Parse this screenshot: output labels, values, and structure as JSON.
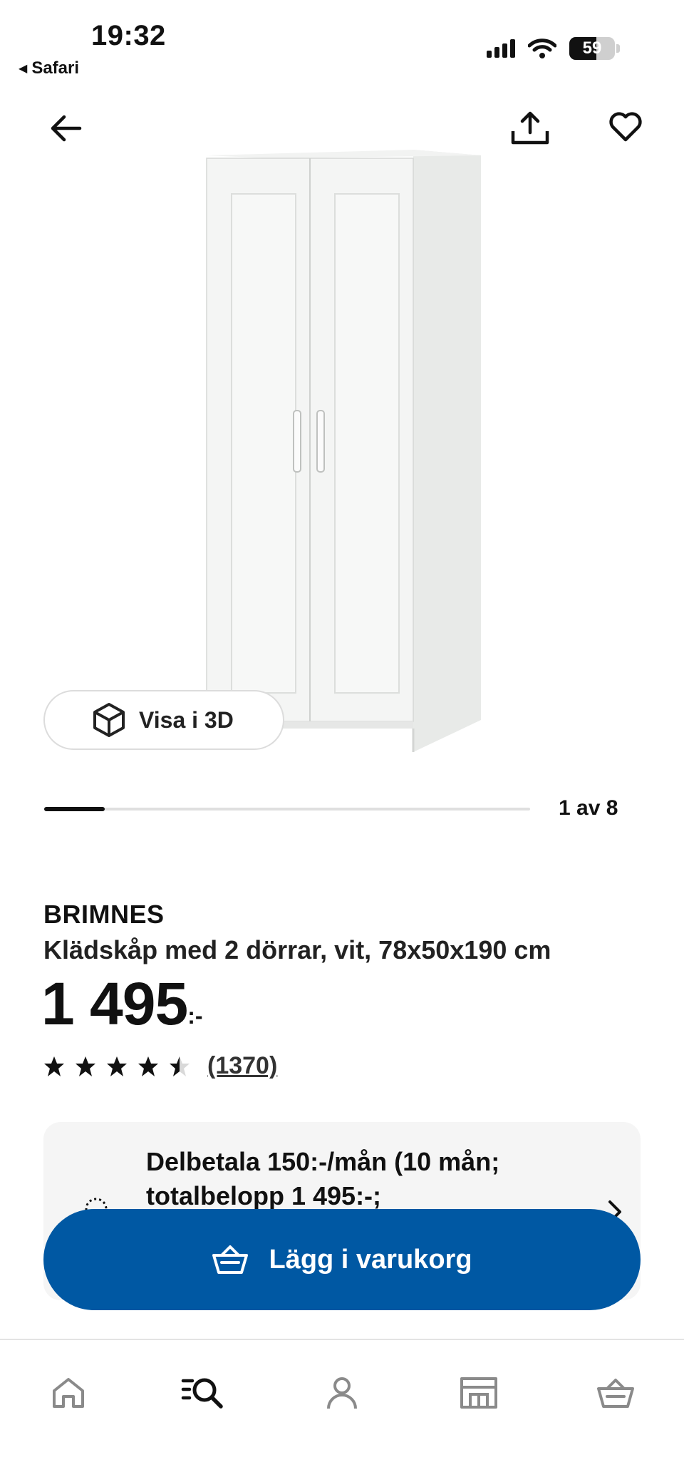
{
  "status_bar": {
    "time": "19:32",
    "back_app": "Safari",
    "battery": "59",
    "battery_level": 0.59
  },
  "product": {
    "image_count_text": "1 av 8",
    "image_index": 1,
    "image_total": 8,
    "view_3d_label": "Visa i 3D",
    "brand": "BRIMNES",
    "description": "Klädskåp med 2 dörrar, vit, 78x50x190 cm",
    "price": "1 495",
    "price_suffix": ":-",
    "rating": 4.5,
    "rating_max": 5,
    "review_count": "(1370)"
  },
  "installment": {
    "text": "Delbetala 150:-/mån (10 mån; totalbelopp 1 495:-;"
  },
  "actions": {
    "add_to_cart": "Lägg i varukorg"
  },
  "colors": {
    "primary": "#0058a3",
    "card_bg": "#f5f5f5",
    "icon_gray": "#8a8a8a"
  },
  "icons": {
    "back": "arrow-left-icon",
    "share": "share-icon",
    "favorite": "heart-icon",
    "view_3d": "cube-icon",
    "cart": "basket-icon",
    "nav": [
      "home-icon",
      "search-list-icon",
      "profile-icon",
      "store-icon",
      "basket-icon"
    ]
  }
}
